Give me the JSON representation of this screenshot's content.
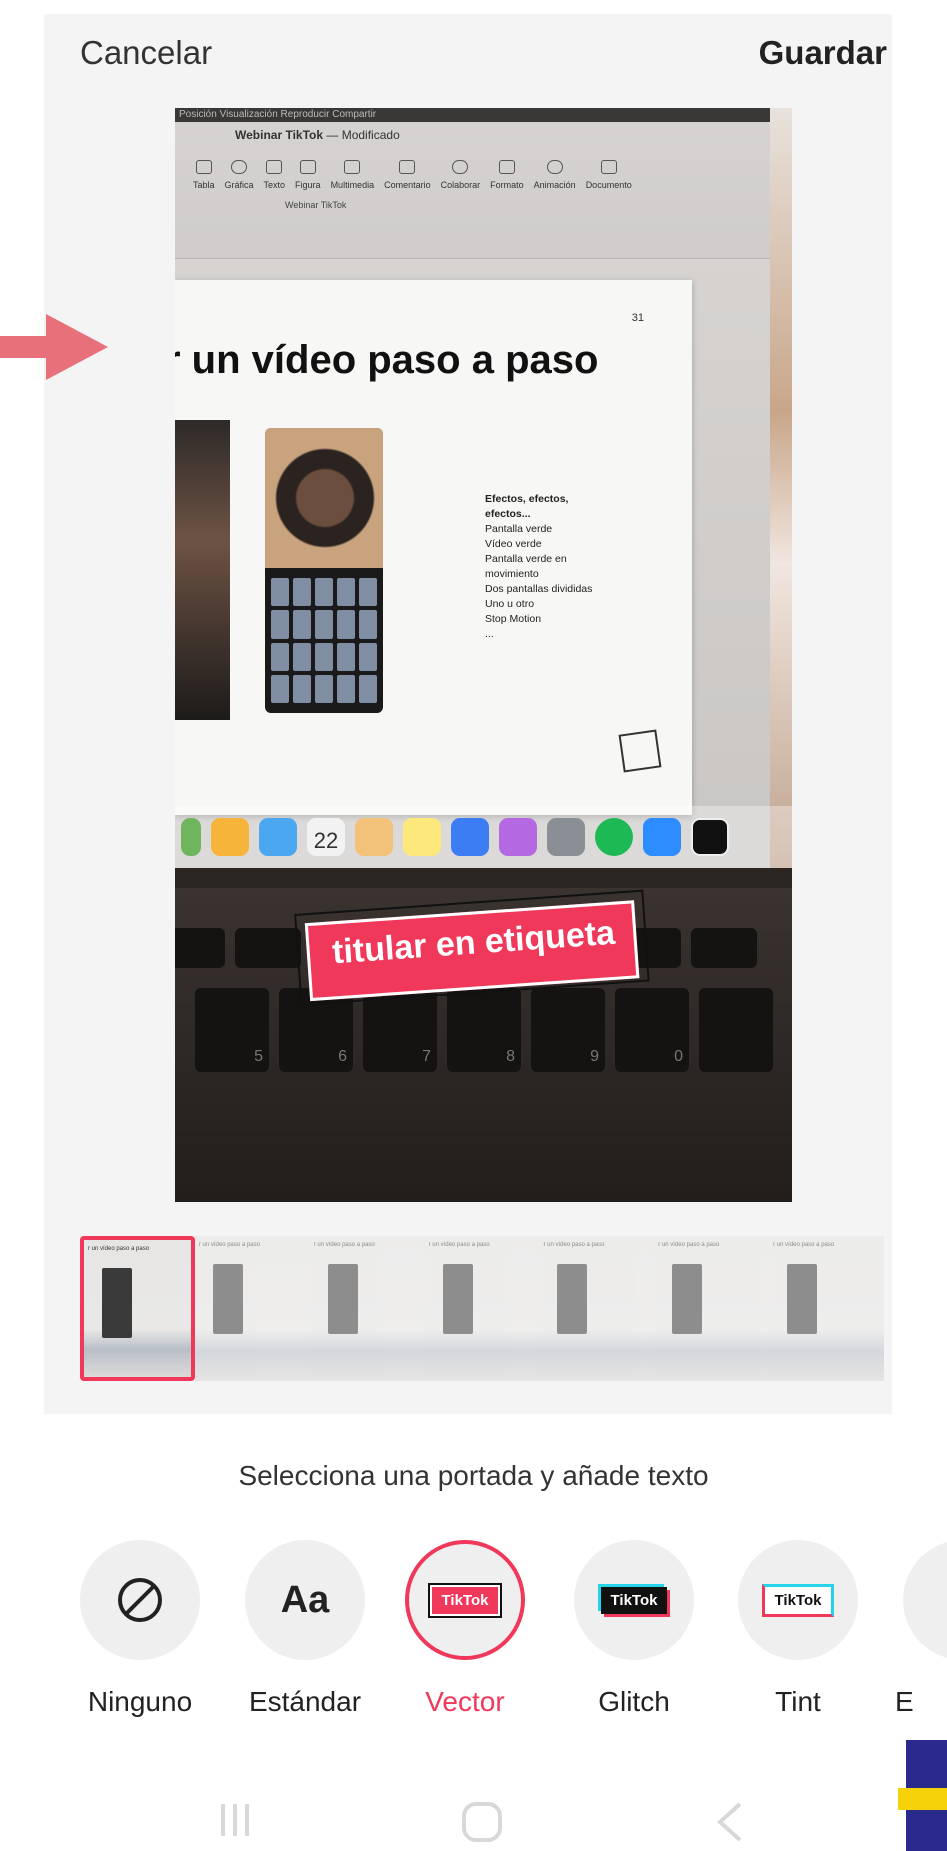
{
  "header": {
    "cancel_label": "Cancelar",
    "save_label": "Guardar"
  },
  "preview": {
    "app_window": {
      "menu": "Posición   Visualización   Reproducir   Compartir",
      "doc_title": "Webinar TikTok",
      "doc_status": "— Modificado",
      "tools": [
        "Tabla",
        "Gráfica",
        "Texto",
        "Figura",
        "Multimedia",
        "Comentario",
        "Colaborar",
        "Formato",
        "Animación",
        "Documento"
      ],
      "subtab": "Webinar TikTok"
    },
    "slide": {
      "number": "31",
      "title": "r un vídeo paso a paso",
      "list_heading": "Efectos, efectos, efectos...",
      "list_items": [
        "Pantalla verde",
        "Vídeo verde",
        "Pantalla verde en movimiento",
        "Dos pantallas divididas",
        "Uno u otro",
        "Stop Motion",
        "..."
      ]
    },
    "dock_date": "22",
    "sticker_text": "titular en etiqueta",
    "keyboard_keys": [
      "5",
      "6",
      "7",
      "8",
      "9",
      "0"
    ]
  },
  "filmstrip": {
    "thumb_text": "r un vídeo paso a paso",
    "count": 7,
    "selected_index": 0
  },
  "hint": "Selecciona una portada y añade texto",
  "text_styles": [
    {
      "label": "Ninguno",
      "icon": "prohibited-icon"
    },
    {
      "label": "Estándar",
      "icon_text": "Aa"
    },
    {
      "label": "Vector",
      "icon_text": "TikTok",
      "selected": true
    },
    {
      "label": "Glitch",
      "icon_text": "TikTok"
    },
    {
      "label": "Tint",
      "icon_text": "TikTok"
    },
    {
      "label": "E"
    }
  ],
  "colors": {
    "accent": "#f0385a",
    "arrow": "#e8707a"
  }
}
